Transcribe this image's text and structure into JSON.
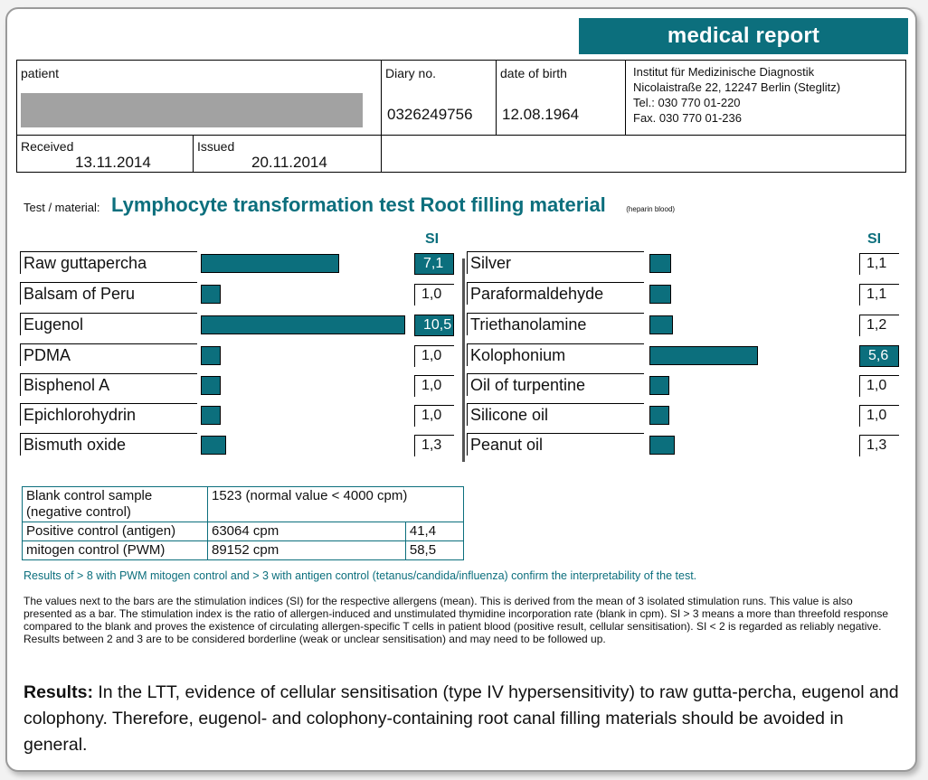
{
  "banner": "medical report",
  "header": {
    "patient_label": "patient",
    "diary_label": "Diary no.",
    "diary_value": "0326249756",
    "dob_label": "date of birth",
    "dob_value": "12.08.1964",
    "institute": [
      "Institut für Medizinische Diagnostik",
      "Nicolaistraße 22, 12247 Berlin (Steglitz)",
      "Tel.: 030 770 01-220",
      "Fax. 030 770 01-236"
    ],
    "received_label": "Received",
    "received_value": "13.11.2014",
    "issued_label": "Issued",
    "issued_value": "20.11.2014"
  },
  "test": {
    "label": "Test / material:",
    "title": "Lymphocyte transformation test Root filling material",
    "note": "(heparin blood)"
  },
  "si_header": "SI",
  "allergens_left": [
    {
      "name": "Raw guttapercha",
      "si": "7,1",
      "value": 7.1,
      "high": true
    },
    {
      "name": "Balsam of Peru",
      "si": "1,0",
      "value": 1.0,
      "high": false
    },
    {
      "name": "Eugenol",
      "si": "10,5",
      "value": 10.5,
      "high": true
    },
    {
      "name": "PDMA",
      "si": "1,0",
      "value": 1.0,
      "high": false
    },
    {
      "name": "Bisphenol A",
      "si": "1,0",
      "value": 1.0,
      "high": false
    },
    {
      "name": "Epichlorohydrin",
      "si": "1,0",
      "value": 1.0,
      "high": false
    },
    {
      "name": "Bismuth oxide",
      "si": "1,3",
      "value": 1.3,
      "high": false
    }
  ],
  "allergens_right": [
    {
      "name": "Silver",
      "si": "1,1",
      "value": 1.1,
      "high": false
    },
    {
      "name": "Paraformaldehyde",
      "si": "1,1",
      "value": 1.1,
      "high": false
    },
    {
      "name": "Triethanolamine",
      "si": "1,2",
      "value": 1.2,
      "high": false
    },
    {
      "name": "Kolophonium",
      "si": "5,6",
      "value": 5.6,
      "high": true
    },
    {
      "name": "Oil of turpentine",
      "si": "1,0",
      "value": 1.0,
      "high": false
    },
    {
      "name": "Silicone oil",
      "si": "1,0",
      "value": 1.0,
      "high": false
    },
    {
      "name": "Peanut oil",
      "si": "1,3",
      "value": 1.3,
      "high": false
    }
  ],
  "controls": {
    "blank_label": "Blank control sample (negative control)",
    "blank_value": "1523   (normal value < 4000 cpm)",
    "positive_label": "Positive control (antigen)",
    "positive_value": "63064   cpm",
    "positive_si": "41,4",
    "mitogen_label": "mitogen control (PWM)",
    "mitogen_value": "89152   cpm",
    "mitogen_si": "58,5"
  },
  "interpretation_note": "Results of > 8 with PWM mitogen control and > 3 with antigen control (tetanus/candida/influenza) confirm the interpretability of the test.",
  "explanation": "The values next to the bars are the stimulation indices (SI) for the respective allergens (mean). This is derived from the mean of 3 isolated stimulation runs. This value is also presented as a bar. The stimulation index is the ratio of allergen-induced and unstimulated thymidine incorporation rate (blank in cpm). SI > 3 means a more than threefold response compared to the blank and proves the existence of circulating allergen-specific T cells in patient blood (positive result, cellular sensitisation). SI < 2 is regarded as reliably negative. Results between 2 and 3 are to be considered borderline (weak or unclear sensitisation) and may need to be followed up.",
  "results_label": "Results:",
  "results_text": "In the LTT, evidence of cellular sensitisation (type IV hypersensitivity) to raw gutta-percha, eugenol and colophony. Therefore, eugenol- and colophony-containing root canal filling materials should be avoided in general.",
  "colors": {
    "accent": "#0c6f7d"
  }
}
